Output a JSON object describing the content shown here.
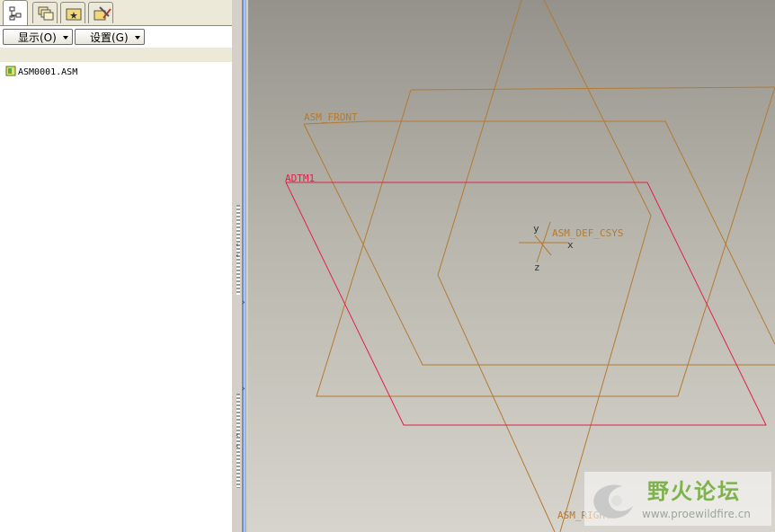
{
  "panel": {
    "tabs": [
      {
        "icon": "model-tree-icon"
      },
      {
        "icon": "layers-icon"
      },
      {
        "icon": "folder-browser-icon"
      },
      {
        "icon": "favorites-tools-icon"
      }
    ],
    "show_menu_label": "显示(O)",
    "settings_menu_label": "设置(G)",
    "tree": [
      {
        "label": "ASM0001.ASM",
        "icon": "assembly-icon"
      }
    ]
  },
  "viewport": {
    "datum_planes": [
      {
        "name": "ASM_FRONT",
        "color": "#b57a32"
      },
      {
        "name": "ADTM1",
        "color": "#e0204a"
      },
      {
        "name": "ASM_RIGHT",
        "color": "#b57a32"
      }
    ],
    "csys": {
      "name": "ASM_DEF_CSYS",
      "axes": [
        "y",
        "x",
        "z"
      ]
    }
  },
  "watermark": {
    "title": "野火论坛",
    "url": "www.proewildfire.cn"
  },
  "colors": {
    "datum": "#b57a32",
    "selected_datum": "#e0204a",
    "sash_accent": "#6f8dc6"
  }
}
